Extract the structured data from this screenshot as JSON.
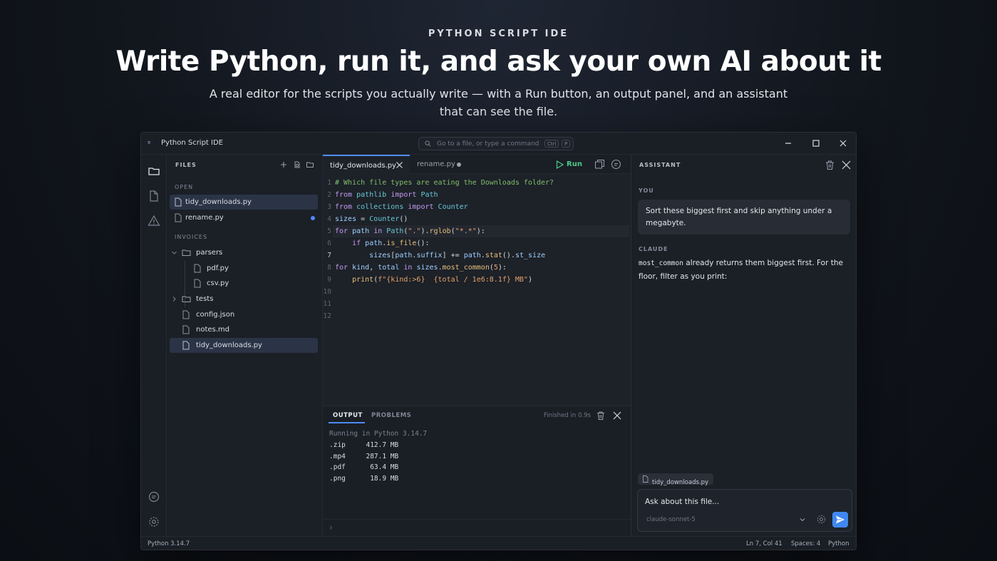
{
  "hero": {
    "eyebrow": "PYTHON SCRIPT IDE",
    "headline": "Write Python, run it, and ask your own AI about it",
    "subhead": "A real editor for the scripts you actually write — with a Run button, an output panel, and an assistant that can see the file."
  },
  "window": {
    "title": "Python Script IDE",
    "logo_text": "≡",
    "command_placeholder": "Go to a file, or type a command",
    "command_shortcut": [
      "Ctrl",
      "P"
    ]
  },
  "explorer": {
    "header": "FILES",
    "open_section": "OPEN",
    "open_files": [
      {
        "name": "tidy_downloads.py",
        "selected": true,
        "modified": false
      },
      {
        "name": "rename.py",
        "selected": false,
        "modified": true
      }
    ],
    "project_section": "INVOICES",
    "tree": [
      {
        "name": "parsers",
        "type": "folder",
        "expanded": true
      },
      {
        "name": "pdf.py",
        "type": "file"
      },
      {
        "name": "csv.py",
        "type": "file"
      },
      {
        "name": "tests",
        "type": "folder",
        "expanded": false
      },
      {
        "name": "config.json",
        "type": "file"
      },
      {
        "name": "notes.md",
        "type": "file"
      },
      {
        "name": "tidy_downloads.py",
        "type": "file",
        "selected": true
      }
    ]
  },
  "editor": {
    "tabs": [
      {
        "label": "tidy_downloads.py",
        "active": true
      },
      {
        "label": "rename.py",
        "active": false,
        "modified": true
      }
    ],
    "run_label": "Run",
    "current_line": 7,
    "line_numbers": [
      "1",
      "2",
      "3",
      "4",
      "5",
      "6",
      "7",
      "8",
      "9",
      "10",
      "11",
      "12"
    ]
  },
  "output": {
    "tabs": [
      "OUTPUT",
      "PROBLEMS"
    ],
    "status": "Finished in 0.9s",
    "running_line": "Running in Python 3.14.7",
    "rows": [
      ".zip     412.7 MB",
      ".mp4     287.1 MB",
      ".pdf      63.4 MB",
      ".png      18.9 MB"
    ],
    "prompt_symbol": "›"
  },
  "assistant": {
    "header": "ASSISTANT",
    "you_label": "YOU",
    "user_message": "Sort these biggest first and skip anything under a megabyte.",
    "bot_label": "CLAUDE",
    "reply_code": "most_common",
    "reply_text": " already returns them biggest first. For the floor, filter as you print:",
    "attached_file": "tidy_downloads.py",
    "input_placeholder": "Ask about this file...",
    "model": "claude-sonnet-5"
  },
  "statusbar": {
    "python_version": "Python 3.14.7",
    "cursor": "Ln 7, Col 41",
    "indent": "Spaces: 4",
    "language": "Python"
  },
  "colors": {
    "accent": "#4d8cf5",
    "run": "#4ec98a",
    "send_button": "#3f88f0"
  }
}
